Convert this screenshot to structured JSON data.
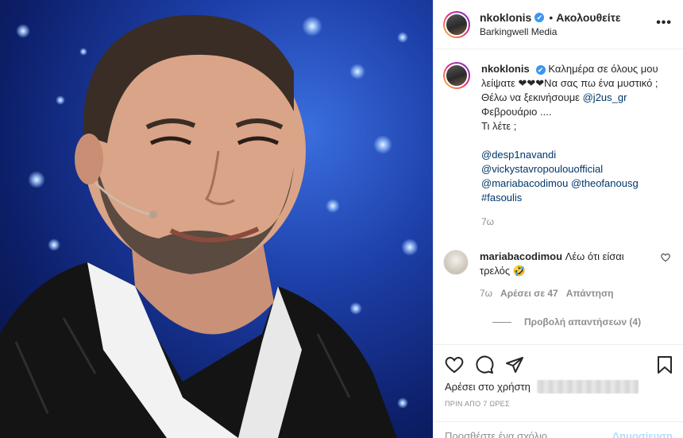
{
  "post": {
    "username": "nkoklonis",
    "verified_mark": "✔",
    "dot": "•",
    "follow_status": "Ακολουθείτε",
    "location": "Barkingwell Media",
    "more_glyph": "•••"
  },
  "caption": {
    "username": "nkoklonis",
    "text_1": "Καλημέρα σε όλους μου λείψατε ❤❤❤Να σας πω ένα μυστικό ; Θέλω να ξεκινήσουμε",
    "mention_1": "@j2us_gr",
    "text_2": " Φεβρουάριο ....",
    "text_3": "Τι λέτε ;",
    "mentions": [
      "@desp1navandi",
      "@vickystavropoulouofficial",
      "@mariabacodimou",
      "@theofanousg"
    ],
    "hashtag": "#fasoulis",
    "age": "7ω"
  },
  "comment": {
    "username": "mariabacodimou",
    "text": "Λέω ότι είσαι τρελός 🤣",
    "age": "7ω",
    "likes": "Αρέσει σε 47",
    "reply": "Απάντηση",
    "view_replies": "Προβολή απαντήσεων (4)"
  },
  "actions": {
    "liked_by": "Αρέσει στο χρήστη",
    "timestamp": "ΠΡΙΝ ΑΠΟ 7 ΩΡΕΣ"
  },
  "composer": {
    "placeholder": "Προσθέστε ένα σχόλιο...",
    "post_label": "Δημοσίευση"
  },
  "colors": {
    "link": "#00376b",
    "verified": "#3897f0",
    "muted": "#8e8e8e",
    "post_button": "#b2dffc"
  },
  "icons": [
    "heart-icon",
    "comment-icon",
    "share-icon",
    "bookmark-icon",
    "more-options-icon",
    "verified-icon"
  ]
}
